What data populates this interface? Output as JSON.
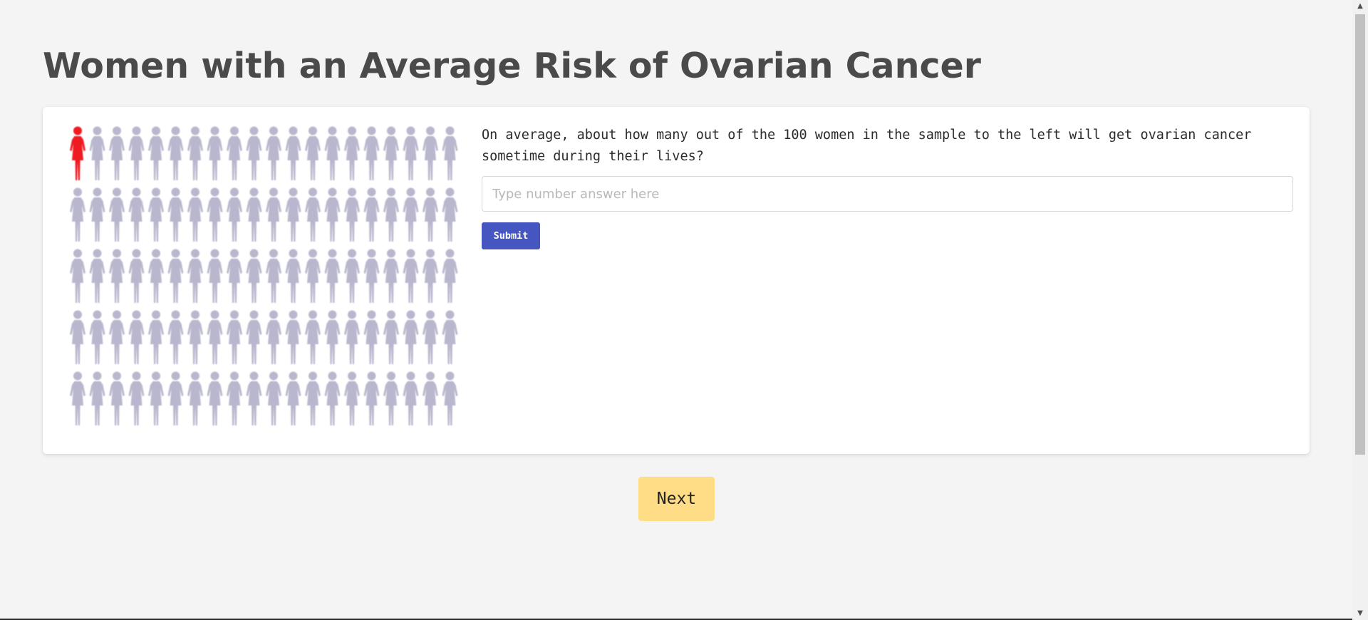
{
  "page": {
    "title": "Women with an Average Risk of Ovarian Cancer"
  },
  "pictogram": {
    "total": 100,
    "affected": 1,
    "columns": 20,
    "rows": 5,
    "affected_color": "#ee1c24",
    "unaffected_color": "#b9b7cd",
    "icon": "woman-figure-icon"
  },
  "question": {
    "text": "On average, about how many out of the 100 women in the sample to the left will get ovarian cancer sometime during their lives?",
    "placeholder": "Type number answer here",
    "value": "",
    "submit_label": "Submit"
  },
  "navigation": {
    "next_label": "Next"
  },
  "colors": {
    "background": "#f4f4f4",
    "card": "#ffffff",
    "title": "#4a4a4a",
    "submit_bg": "#4556c0",
    "submit_text": "#ffffff",
    "next_bg": "#fedd86",
    "next_text": "#222222"
  },
  "scrollbar": {
    "up_icon": "scroll-up-arrow-icon",
    "down_icon": "scroll-down-arrow-icon"
  }
}
